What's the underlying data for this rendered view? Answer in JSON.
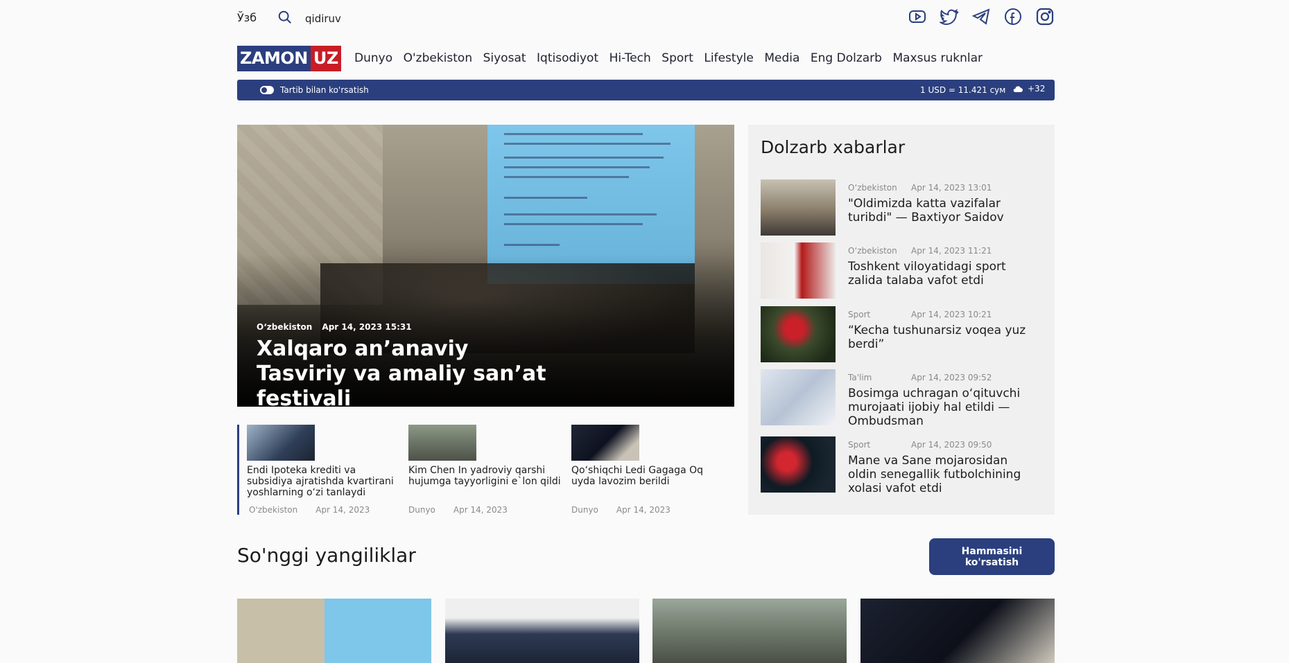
{
  "topbar": {
    "language": "Ўзб",
    "search_placeholder": "qidiruv",
    "socials": [
      "youtube-icon",
      "twitter-icon",
      "telegram-icon",
      "facebook-icon",
      "instagram-icon"
    ]
  },
  "logo": {
    "part1": "ZAMON",
    "part2": "UZ"
  },
  "nav": [
    "Dunyo",
    "O'zbekiston",
    "Siyosat",
    "Iqtisodiyot",
    "Hi-Tech",
    "Sport",
    "Lifestyle",
    "Media",
    "Eng Dolzarb",
    "Maxsus ruknlar"
  ],
  "infobar": {
    "toggle_label": "Tartib bilan ko'rsatish",
    "usd_rate": "1 USD = 11.421 сум",
    "temperature": "+32"
  },
  "hero": {
    "category": "O‘zbekiston",
    "date": "Apr 14, 2023 15:31",
    "title": "Xalqaro an’anaviy Tasviriy va amaliy san’at festivali"
  },
  "minis": [
    {
      "title": "Endi Ipoteka krediti va subsidiya ajratishda kvartirani yoshlarning o‘zi tanlaydi",
      "category": "O'zbekiston",
      "date": "Apr 14, 2023"
    },
    {
      "title": "Kim Chen In yadroviy qarshi hujumga tayyorligini e`lon qildi",
      "category": "Dunyo",
      "date": "Apr 14, 2023"
    },
    {
      "title": "Qo‘shiqchi Ledi Gagaga Oq uyda lavozim berildi",
      "category": "Dunyo",
      "date": "Apr 14, 2023"
    }
  ],
  "sidebar": {
    "title": "Dolzarb xabarlar",
    "items": [
      {
        "category": "O‘zbekiston",
        "date": "Apr 14, 2023 13:01",
        "title": "\"Oldimizda katta vazifalar turibdi\" — Baxtiyor Saidov"
      },
      {
        "category": "O‘zbekiston",
        "date": "Apr 14, 2023 11:21",
        "title": "Toshkent viloyatidagi sport zalida talaba vafot etdi"
      },
      {
        "category": "Sport",
        "date": "Apr 14, 2023 10:21",
        "title": "“Kecha tushunarsiz voqea yuz berdi”"
      },
      {
        "category": "Ta'lim",
        "date": "Apr 14, 2023 09:52",
        "title": "Bosimga uchragan o‘qituvchi murojaati ijobiy hal etildi — Ombudsman"
      },
      {
        "category": "Sport",
        "date": "Apr 14, 2023 09:50",
        "title": "Mane va Sane mojarosidan oldin senegallik futbolchining xolasi vafot etdi"
      }
    ]
  },
  "latest": {
    "title": "So'nggi yangiliklar",
    "button": "Hammasini ko'rsatish"
  },
  "colors": {
    "brand_blue": "#2b3f7e",
    "brand_red": "#c81d25"
  }
}
